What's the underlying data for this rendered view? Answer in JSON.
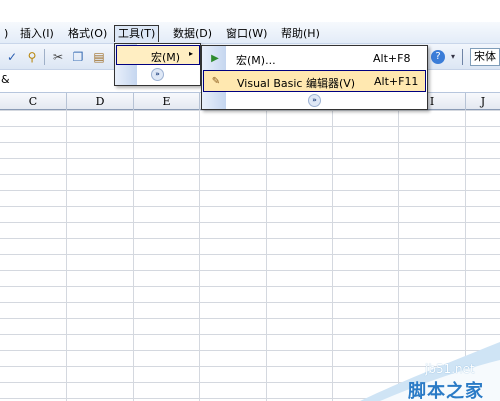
{
  "menubar": {
    "items": [
      {
        "label": ")"
      },
      {
        "label": "插入(I)"
      },
      {
        "label": "格式(O)"
      },
      {
        "label": "工具(T)"
      },
      {
        "label": "数据(D)"
      },
      {
        "label": "窗口(W)"
      },
      {
        "label": "帮助(H)"
      }
    ]
  },
  "toolbar": {
    "font_value": "宋体"
  },
  "formula_bar": {
    "name_box_fragment": "&"
  },
  "columns": [
    "C",
    "D",
    "E",
    "F",
    "G",
    "H",
    "I",
    "J"
  ],
  "tools_menu": {
    "items": [
      {
        "label": "宏(M)",
        "arrow": "▸"
      }
    ],
    "expand_glyph": "»"
  },
  "macro_submenu": {
    "items": [
      {
        "label": "宏(M)...",
        "shortcut": "Alt+F8",
        "icon": "play-triangle-icon"
      },
      {
        "label": "Visual Basic 编辑器(V)",
        "shortcut": "Alt+F11",
        "icon": "vb-editor-icon"
      }
    ],
    "expand_glyph": "»"
  },
  "watermark": {
    "url": "jb51.net",
    "name": "脚本之家"
  },
  "colors": {
    "menu_highlight": "#ffe8b0",
    "menu_border": "#000080",
    "watermark_blue": "#2b7bc6"
  }
}
